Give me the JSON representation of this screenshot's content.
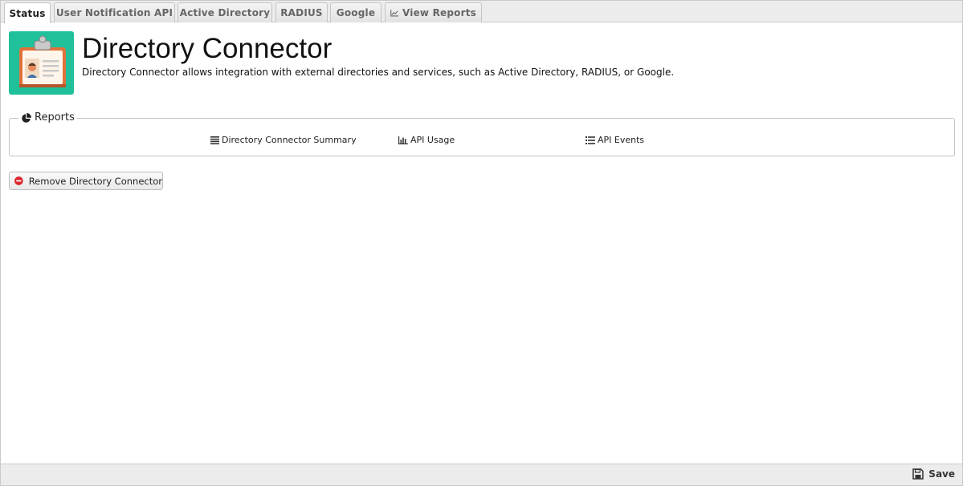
{
  "tabs": [
    {
      "label": "Status",
      "active": true
    },
    {
      "label": "User Notification API",
      "active": false
    },
    {
      "label": "Active Directory",
      "active": false
    },
    {
      "label": "RADIUS",
      "active": false
    },
    {
      "label": "Google",
      "active": false
    },
    {
      "label": "View Reports",
      "active": false,
      "icon": "line-chart-icon"
    }
  ],
  "header": {
    "title": "Directory Connector",
    "description": "Directory Connector allows integration with external directories and services, such as Active Directory, RADIUS, or Google.",
    "icon": "id-badge-clipboard-icon",
    "icon_bg_color": "#1fc09a"
  },
  "reports": {
    "legend": "Reports",
    "legend_icon": "pie-chart-icon",
    "links": [
      {
        "label": "Directory Connector Summary",
        "icon": "align-justify-icon"
      },
      {
        "label": "API Usage",
        "icon": "bar-chart-icon"
      },
      {
        "label": "API Events",
        "icon": "list-icon"
      }
    ]
  },
  "actions": {
    "remove_label": "Remove Directory Connector",
    "remove_icon": "minus-circle-icon",
    "remove_icon_color": "#d9272e"
  },
  "footer": {
    "save_label": "Save",
    "save_icon": "floppy-disk-icon"
  }
}
